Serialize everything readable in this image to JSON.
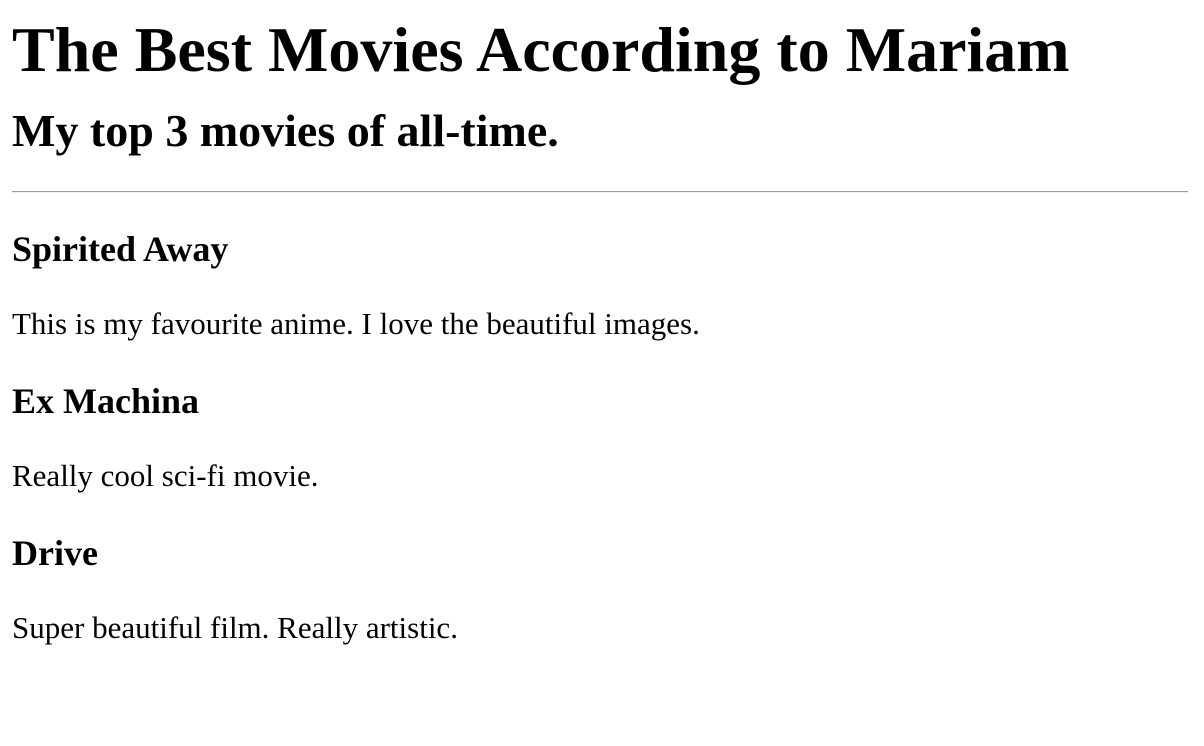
{
  "header": {
    "title": "The Best Movies According to Mariam",
    "subtitle": "My top 3 movies of all-time."
  },
  "movies": [
    {
      "title": "Spirited Away",
      "description": "This is my favourite anime. I love the beautiful images."
    },
    {
      "title": "Ex Machina",
      "description": "Really cool sci-fi movie."
    },
    {
      "title": "Drive",
      "description": "Super beautiful film. Really artistic."
    }
  ]
}
